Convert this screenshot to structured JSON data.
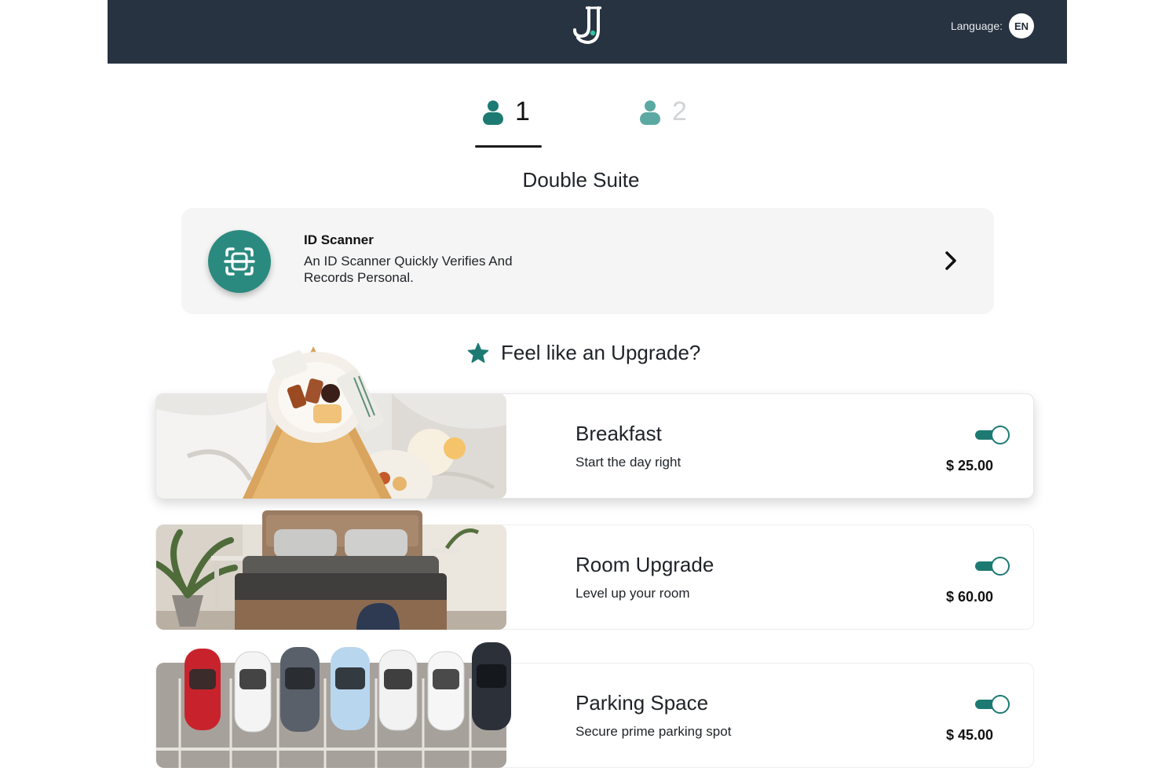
{
  "header": {
    "logo_icon": "jj-logo-icon",
    "language_label": "Language:",
    "language_code": "EN"
  },
  "guests": {
    "tabs": [
      {
        "label": "1",
        "icon": "person-icon",
        "active": true
      },
      {
        "label": "2",
        "icon": "person-icon",
        "active": false
      }
    ]
  },
  "room": {
    "title": "Double Suite"
  },
  "id_scanner": {
    "title": "ID Scanner",
    "description": "An ID Scanner Quickly Verifies And Records Personal.",
    "icon": "scan-icon",
    "action_icon": "chevron-right-icon"
  },
  "upgrade": {
    "heading": "Feel like an Upgrade?",
    "icon": "star-icon",
    "offers": [
      {
        "name": "Breakfast",
        "subtitle": "Start the day right",
        "price": "$ 25.00",
        "enabled": true,
        "image": "breakfast-tray-image"
      },
      {
        "name": "Room Upgrade",
        "subtitle": "Level up your room",
        "price": "$ 60.00",
        "enabled": true,
        "image": "bedroom-image"
      },
      {
        "name": "Parking Space",
        "subtitle": "Secure prime parking spot",
        "price": "$ 45.00",
        "enabled": true,
        "image": "parking-lot-image"
      }
    ]
  },
  "colors": {
    "header_bg": "#283341",
    "accent": "#1d7a73",
    "accent_light": "#5ba9a2",
    "card_bg": "#f5f5f5"
  }
}
